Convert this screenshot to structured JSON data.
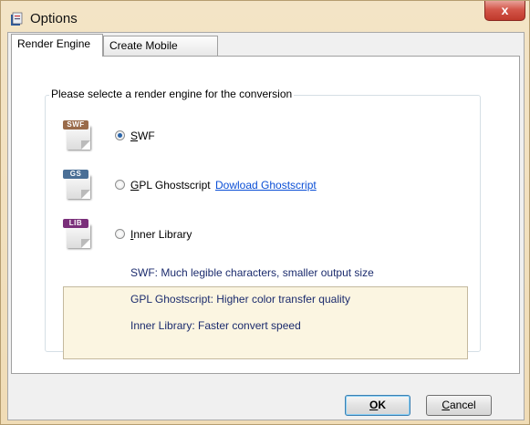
{
  "window": {
    "title": "Options",
    "close_label": "x"
  },
  "tabs": [
    {
      "label": "Render Engine",
      "active": true
    },
    {
      "label": "Create Mobile Version",
      "active": false
    }
  ],
  "group": {
    "legend": "Please selecte a render engine for the conversion"
  },
  "engines": [
    {
      "icon_tag": "SWF",
      "icon_color": "#9a6b4a",
      "mnemonic": "S",
      "label_rest": "WF",
      "checked": true
    },
    {
      "icon_tag": "GS",
      "icon_color": "#4a6f96",
      "mnemonic": "G",
      "label_rest": "PL Ghostscript",
      "checked": false
    },
    {
      "icon_tag": "LIB",
      "icon_color": "#7a2f7a",
      "mnemonic": "I",
      "label_rest": "nner Library",
      "checked": false
    }
  ],
  "download_link": "Dowload Ghostscript",
  "info": [
    "SWF: Much legible characters, smaller output size",
    "GPL Ghostscript: Higher color transfer quality",
    "Inner Library: Faster convert speed"
  ],
  "buttons": {
    "ok_mnemonic": "O",
    "ok_rest": "K",
    "cancel_mnemonic": "C",
    "cancel_rest": "ancel"
  }
}
